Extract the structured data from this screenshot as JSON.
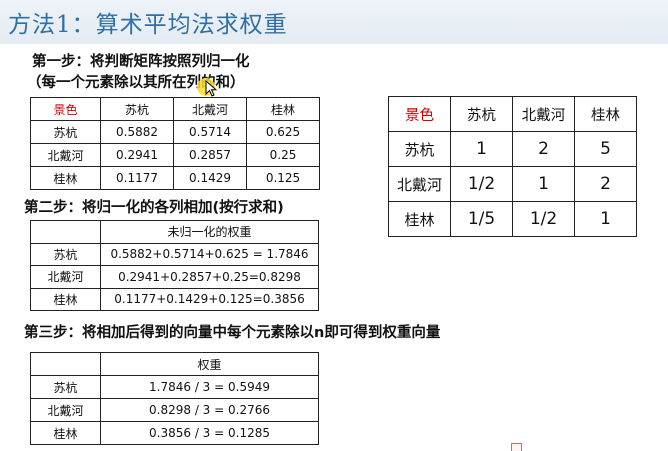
{
  "title": "方法1：算术平均法求权重",
  "step1": {
    "line1": "第一步：将判断矩阵按照列归一化",
    "line2": "（每一个元素除以其所在列的和）"
  },
  "table1": {
    "header": [
      "景色",
      "苏杭",
      "北戴河",
      "桂林"
    ],
    "rows": [
      [
        "苏杭",
        "0.5882",
        "0.5714",
        "0.625"
      ],
      [
        "北戴河",
        "0.2941",
        "0.2857",
        "0.25"
      ],
      [
        "桂林",
        "0.1177",
        "0.1429",
        "0.125"
      ]
    ]
  },
  "step2": "第二步：将归一化的各列相加(按行求和)",
  "table2": {
    "header": [
      "",
      "未归一化的权重"
    ],
    "rows": [
      [
        "苏杭",
        "0.5882+0.5714+0.625 = 1.7846"
      ],
      [
        "北戴河",
        "0.2941+0.2857+0.25=0.8298"
      ],
      [
        "桂林",
        "0.1177+0.1429+0.125=0.3856"
      ]
    ]
  },
  "step3": "第三步：将相加后得到的向量中每个元素除以n即可得到权重向量",
  "table3": {
    "header": [
      "",
      "权重"
    ],
    "rows": [
      [
        "苏杭",
        "1.7846 / 3 = 0.5949"
      ],
      [
        "北戴河",
        "0.8298 / 3 = 0.2766"
      ],
      [
        "桂林",
        "0.3856 / 3 = 0.1285"
      ]
    ]
  },
  "matrix": {
    "header": [
      "景色",
      "苏杭",
      "北戴河",
      "桂林"
    ],
    "rows": [
      [
        "苏杭",
        "1",
        "2",
        "5"
      ],
      [
        "北戴河",
        "1/2",
        "1",
        "2"
      ],
      [
        "桂林",
        "1/5",
        "1/2",
        "1"
      ]
    ]
  },
  "colors": {
    "title": "#2e6fa8",
    "header_red": "#d40000",
    "highlight": "#ffdc28"
  },
  "icons": [
    "mouse-pointer-icon",
    "cursor-highlight"
  ]
}
